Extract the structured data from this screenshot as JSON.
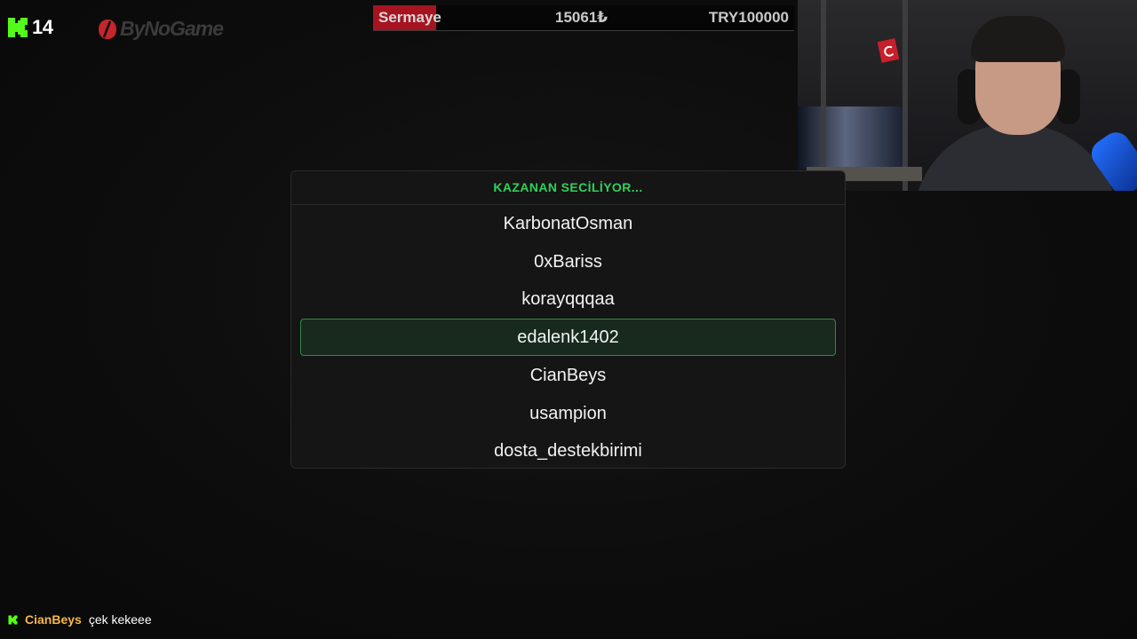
{
  "colors": {
    "kick_green": "#53fc18",
    "accent_green": "#2fd15a",
    "selected_border": "#2f8a48",
    "capital_fill": "#a51420",
    "chat_username": "#f5b84c"
  },
  "top_logos": {
    "kick_icon": "kick-logo-icon",
    "viewer_count": "14",
    "sponsor_icon": "bynogame-logo-icon",
    "sponsor_text": "ByNoGame"
  },
  "capital": {
    "label": "Sermaye",
    "current": "15061₺",
    "target": "TRY100000",
    "progress_fraction": 0.1506
  },
  "picker": {
    "title": "KAZANAN SECİLİYOR...",
    "entries": [
      "KarbonatOsman",
      "0xBariss",
      "korayqqqaa",
      "edalenk1402",
      "CianBeys",
      "usampion",
      "dosta_destekbirimi"
    ],
    "selected_index": 3
  },
  "chat": {
    "platform_icon": "kick-logo-icon",
    "username": "CianBeys",
    "message": "çek kekeee"
  }
}
